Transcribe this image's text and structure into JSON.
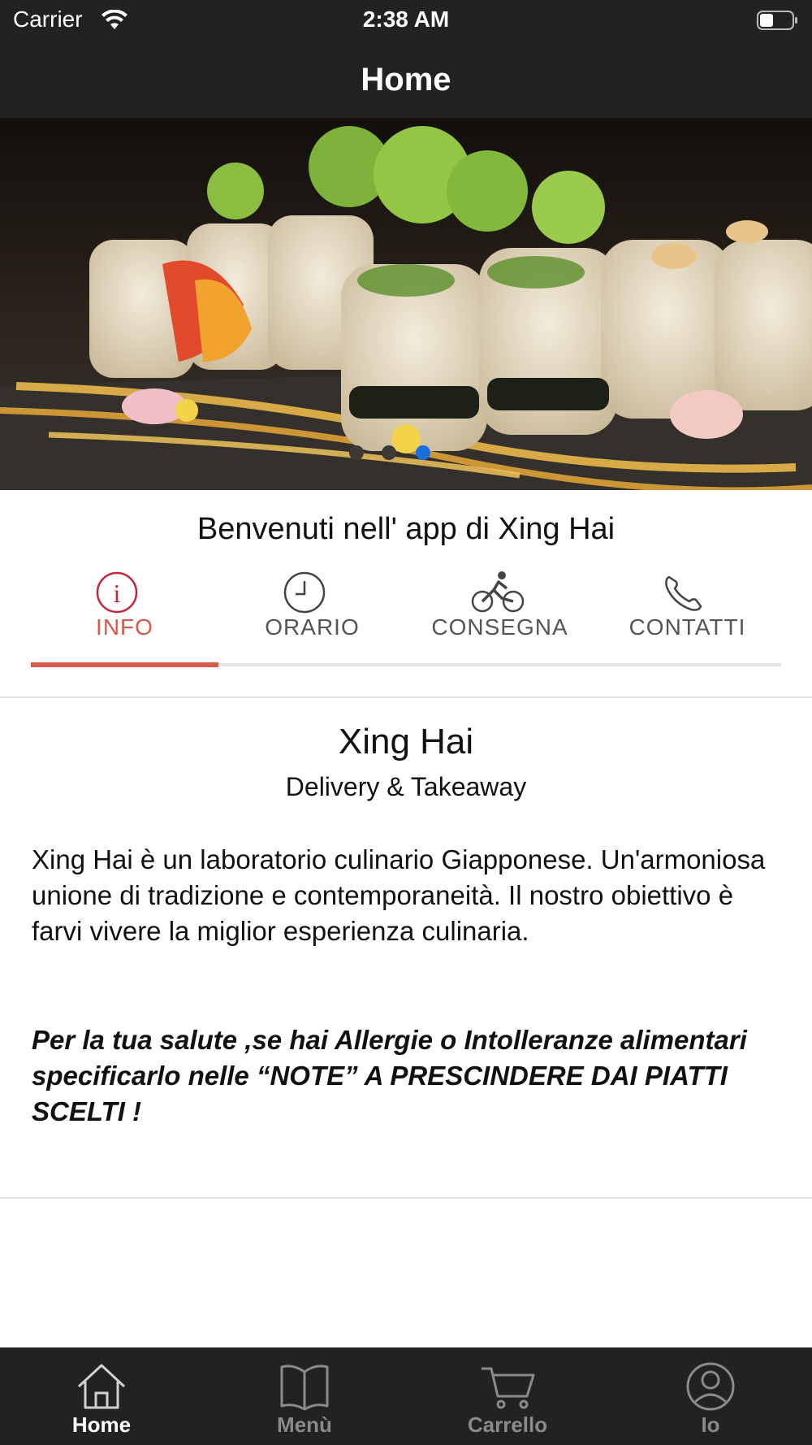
{
  "status_bar": {
    "carrier": "Carrier",
    "time": "2:38 AM",
    "icons": [
      "wifi-icon",
      "battery-icon"
    ]
  },
  "nav": {
    "title": "Home"
  },
  "hero": {
    "slide_count": 3,
    "active_slide": 3,
    "dot_colors": {
      "active": "#1a6fe0",
      "inactive": "#3a3a3a"
    }
  },
  "welcome_text": "Benvenuti nell' app di Xing Hai",
  "tabs": [
    {
      "label": "INFO",
      "icon": "info-icon",
      "active": true
    },
    {
      "label": "ORARIO",
      "icon": "clock-icon",
      "active": false
    },
    {
      "label": "CONSEGNA",
      "icon": "bicycle-icon",
      "active": false
    },
    {
      "label": "CONTATTI",
      "icon": "phone-icon",
      "active": false
    }
  ],
  "info": {
    "title": "Xing Hai",
    "subtitle": "Delivery & Takeaway",
    "description": "Xing Hai è un laboratorio culinario Giapponese. Un'armoniosa unione di tradizione e contemporaneità. Il nostro obiettivo è farvi vivere la miglior esperienza culinaria.",
    "note": "Per la tua salute ,se hai Allergie o Intolleranze alimentari specificarlo nelle “NOTE” A PRESCINDERE DAI PIATTI SCELTI !"
  },
  "tab_bar": [
    {
      "label": "Home",
      "icon": "home-icon",
      "active": true
    },
    {
      "label": "Menù",
      "icon": "book-icon",
      "active": false
    },
    {
      "label": "Carrello",
      "icon": "cart-icon",
      "active": false
    },
    {
      "label": "Io",
      "icon": "user-icon",
      "active": false
    }
  ],
  "colors": {
    "bar_background": "#222222",
    "accent": "#d85a4a",
    "tab_active_label": "#d7574a",
    "tab_inactive_label": "#555555"
  }
}
